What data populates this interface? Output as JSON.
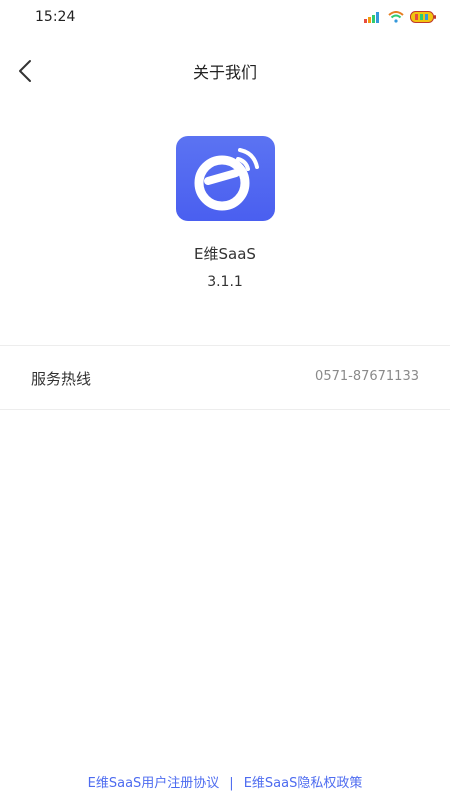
{
  "status_bar": {
    "time": "15:24",
    "icons": [
      "signal-icon",
      "wifi-icon",
      "battery-icon"
    ]
  },
  "nav": {
    "back_icon": "chevron-left-icon",
    "title": "关于我们"
  },
  "app": {
    "logo_icon": "e-logo-icon",
    "name": "E维SaaS",
    "version": "3.1.1"
  },
  "service": {
    "label": "服务热线",
    "value": "0571-87671133"
  },
  "footer": {
    "user_agreement": "E维SaaS用户注册协议",
    "separator": "|",
    "privacy_policy": "E维SaaS隐私权政策"
  },
  "colors": {
    "accent": "#4e6cf0",
    "logo_bg": "#5066f0",
    "text_primary": "#333333",
    "text_secondary": "#8a8a8a",
    "divider": "#ededed"
  }
}
